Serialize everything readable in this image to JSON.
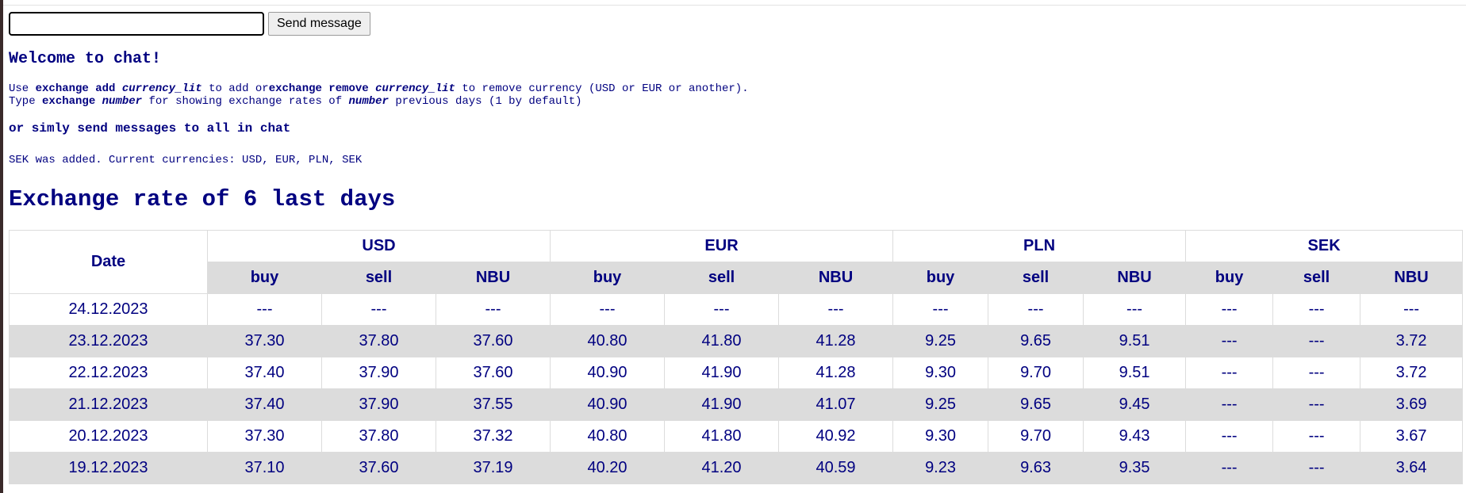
{
  "chat": {
    "input_value": "",
    "send_label": "Send message"
  },
  "welcome": "Welcome to chat!",
  "help": {
    "line1": {
      "p1": "Use ",
      "cmd_add": "exchange add",
      "space1": " ",
      "arg_add": "currency_lit",
      "p2": " to add or",
      "cmd_remove": "exchange remove",
      "space2": " ",
      "arg_remove": "currency_lit",
      "p3": " to remove currency (USD or EUR or another)."
    },
    "line2": {
      "p1": "Type ",
      "cmd": "exchange",
      "space": " ",
      "arg": "number",
      "p2": " for showing exchange rates of ",
      "arg2": "number",
      "p3": " previous days (1 by default)"
    }
  },
  "simply": "or simly send messages to all in chat",
  "added_message": "SEK was added. Current currencies: USD, EUR, PLN, SEK",
  "rates_title": "Exchange rate of 6 last days",
  "table": {
    "date_header": "Date",
    "currencies": [
      "USD",
      "EUR",
      "PLN",
      "SEK"
    ],
    "sub_headers": [
      "buy",
      "sell",
      "NBU"
    ],
    "rows": [
      {
        "date": "24.12.2023",
        "cells": [
          "---",
          "---",
          "---",
          "---",
          "---",
          "---",
          "---",
          "---",
          "---",
          "---",
          "---",
          "---"
        ]
      },
      {
        "date": "23.12.2023",
        "cells": [
          "37.30",
          "37.80",
          "37.60",
          "40.80",
          "41.80",
          "41.28",
          "9.25",
          "9.65",
          "9.51",
          "---",
          "---",
          "3.72"
        ]
      },
      {
        "date": "22.12.2023",
        "cells": [
          "37.40",
          "37.90",
          "37.60",
          "40.90",
          "41.90",
          "41.28",
          "9.30",
          "9.70",
          "9.51",
          "---",
          "---",
          "3.72"
        ]
      },
      {
        "date": "21.12.2023",
        "cells": [
          "37.40",
          "37.90",
          "37.55",
          "40.90",
          "41.90",
          "41.07",
          "9.25",
          "9.65",
          "9.45",
          "---",
          "---",
          "3.69"
        ]
      },
      {
        "date": "20.12.2023",
        "cells": [
          "37.30",
          "37.80",
          "37.32",
          "40.80",
          "41.80",
          "40.92",
          "9.30",
          "9.70",
          "9.43",
          "---",
          "---",
          "3.67"
        ]
      },
      {
        "date": "19.12.2023",
        "cells": [
          "37.10",
          "37.60",
          "37.19",
          "40.20",
          "41.20",
          "40.59",
          "9.23",
          "9.63",
          "9.35",
          "---",
          "---",
          "3.64"
        ]
      }
    ]
  }
}
